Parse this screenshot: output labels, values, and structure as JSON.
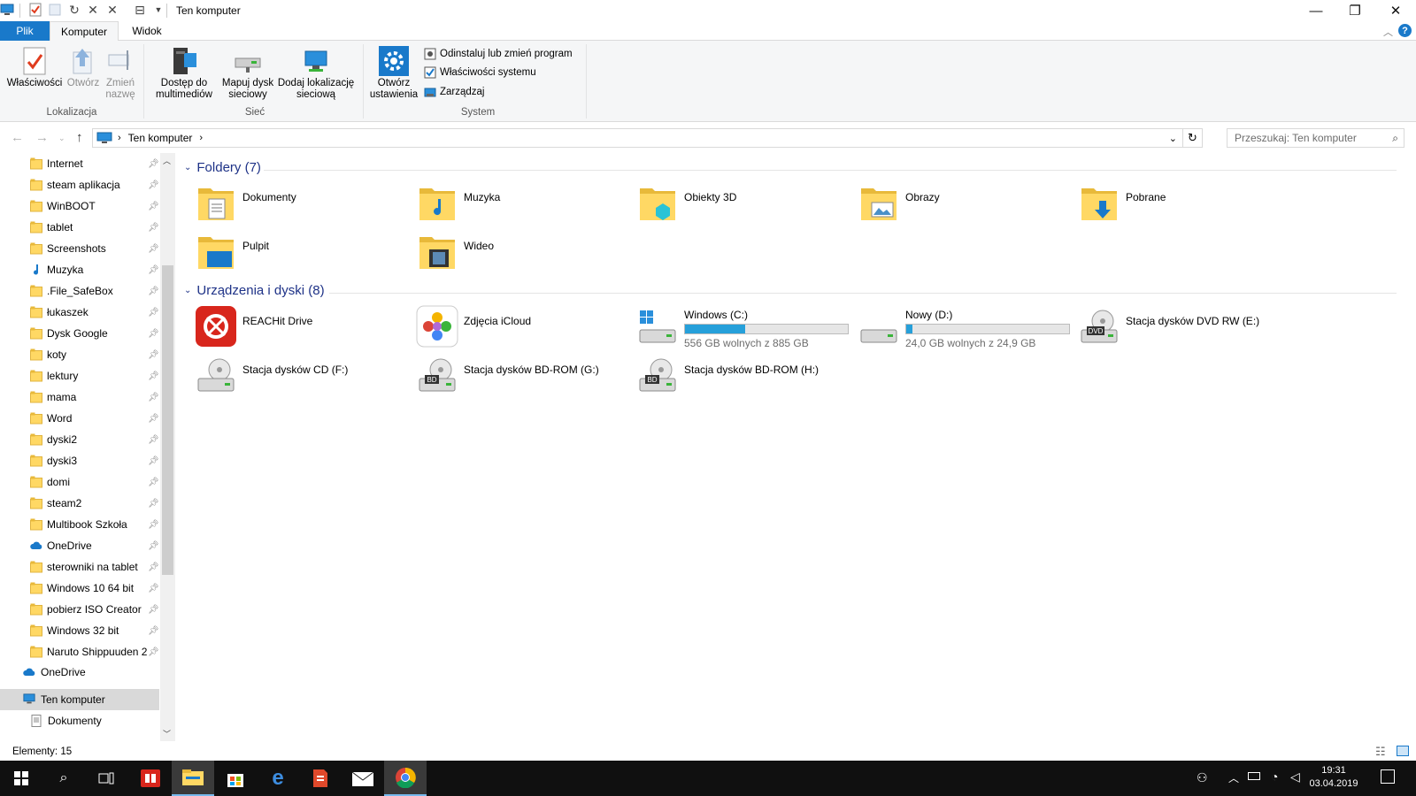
{
  "window": {
    "title": "Ten komputer",
    "controls": {
      "minimize": "—",
      "maximize": "❐",
      "close": "✕"
    }
  },
  "ribbon_tabs": [
    {
      "label": "Plik"
    },
    {
      "label": "Komputer"
    },
    {
      "label": "Widok"
    }
  ],
  "ribbon": {
    "groups": {
      "location": "Lokalizacja",
      "network": "Sieć",
      "system": "System"
    },
    "buttons": {
      "properties": "Właściwości",
      "open": "Otwórz",
      "rename_1": "Zmień",
      "rename_2": "nazwę",
      "media_1": "Dostęp do",
      "media_2": "multimediów",
      "map_1": "Mapuj dysk",
      "map_2": "sieciowy",
      "addloc_1": "Dodaj lokalizację",
      "addloc_2": "sieciową",
      "settings_1": "Otwórz",
      "settings_2": "ustawienia",
      "uninstall": "Odinstaluj lub zmień program",
      "sysprops": "Właściwości systemu",
      "manage": "Zarządzaj"
    }
  },
  "address": {
    "path": "Ten komputer",
    "search_placeholder": "Przeszukaj: Ten komputer"
  },
  "sidebar": {
    "quick_access": [
      {
        "label": "Internet",
        "icon": "folder-icon"
      },
      {
        "label": "steam aplikacja",
        "icon": "folder-icon"
      },
      {
        "label": "WinBOOT",
        "icon": "folder-icon"
      },
      {
        "label": "tablet",
        "icon": "folder-icon"
      },
      {
        "label": "Screenshots",
        "icon": "folder-icon"
      },
      {
        "label": "Muzyka",
        "icon": "music-icon"
      },
      {
        "label": ".File_SafeBox",
        "icon": "folder-icon"
      },
      {
        "label": "łukaszek",
        "icon": "folder-icon"
      },
      {
        "label": "Dysk Google",
        "icon": "folder-icon"
      },
      {
        "label": "koty",
        "icon": "folder-icon"
      },
      {
        "label": "lektury",
        "icon": "folder-icon"
      },
      {
        "label": "mama",
        "icon": "folder-icon"
      },
      {
        "label": "Word",
        "icon": "folder-icon"
      },
      {
        "label": "dyski2",
        "icon": "folder-icon"
      },
      {
        "label": "dyski3",
        "icon": "folder-icon"
      },
      {
        "label": "domi",
        "icon": "folder-icon"
      },
      {
        "label": "steam2",
        "icon": "folder-icon"
      },
      {
        "label": "Multibook Szkoła",
        "icon": "folder-icon"
      },
      {
        "label": "OneDrive",
        "icon": "cloud-icon"
      },
      {
        "label": "sterowniki na tablet",
        "icon": "folder-icon"
      },
      {
        "label": "Windows 10  64 bit",
        "icon": "folder-icon"
      },
      {
        "label": "pobierz ISO Creator",
        "icon": "folder-icon"
      },
      {
        "label": "Windows 32 bit",
        "icon": "folder-icon"
      },
      {
        "label": "Naruto Shippuuden 2",
        "icon": "folder-icon"
      }
    ],
    "onedrive": "OneDrive",
    "this_pc": "Ten komputer",
    "documents": "Dokumenty"
  },
  "sections": {
    "folders": "Foldery (7)",
    "devices": "Urządzenia i dyski (8)"
  },
  "folders": [
    {
      "name": "Dokumenty",
      "icon": "documents-folder-icon"
    },
    {
      "name": "Muzyka",
      "icon": "music-folder-icon"
    },
    {
      "name": "Obiekty 3D",
      "icon": "3d-objects-folder-icon"
    },
    {
      "name": "Obrazy",
      "icon": "pictures-folder-icon"
    },
    {
      "name": "Pobrane",
      "icon": "downloads-folder-icon"
    },
    {
      "name": "Pulpit",
      "icon": "desktop-folder-icon"
    },
    {
      "name": "Wideo",
      "icon": "videos-folder-icon"
    }
  ],
  "devices": [
    {
      "name": "REACHit Drive",
      "icon": "reachit-drive-icon"
    },
    {
      "name": "Zdjęcia iCloud",
      "icon": "icloud-photos-icon"
    },
    {
      "name": "Windows (C:)",
      "free": "556 GB wolnych z 885 GB",
      "used_fraction": 0.37,
      "icon": "windows-drive-icon"
    },
    {
      "name": "Nowy (D:)",
      "free": "24,0 GB wolnych z 24,9 GB",
      "used_fraction": 0.04,
      "icon": "hard-drive-icon"
    },
    {
      "name": "Stacja dysków DVD RW (E:)",
      "icon": "dvd-drive-icon",
      "badge": "DVD"
    },
    {
      "name": "Stacja dysków CD (F:)",
      "icon": "cd-drive-icon"
    },
    {
      "name": "Stacja dysków BD-ROM (G:)",
      "icon": "bd-drive-icon",
      "badge": "BD"
    },
    {
      "name": "Stacja dysków BD-ROM (H:)",
      "icon": "bd-drive-icon",
      "badge": "BD"
    }
  ],
  "status": {
    "items": "Elementy: 15"
  },
  "taskbar": {
    "time": "19:31",
    "date": "03.04.2019"
  },
  "colors": {
    "accent": "#1979ca",
    "section_heading": "#1e3287",
    "folder": "#ffd864",
    "drive_bar": "#26a0da",
    "taskbar": "#101010"
  }
}
